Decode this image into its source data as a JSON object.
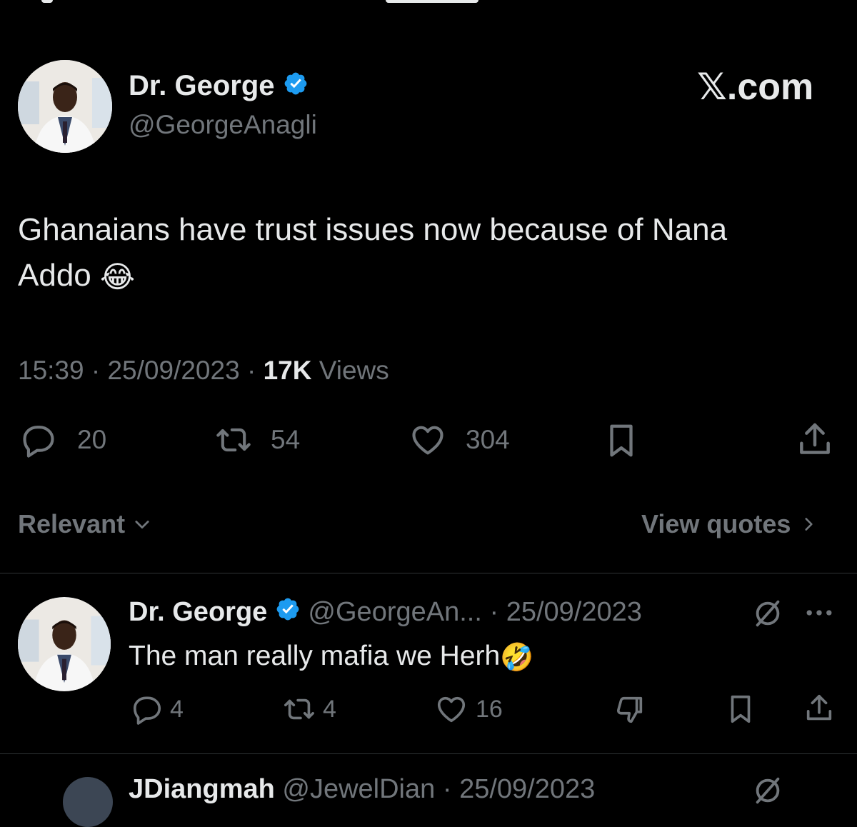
{
  "brand": {
    "logo_text": "𝕏.com"
  },
  "main_tweet": {
    "author_name": "Dr. George",
    "author_handle": "@GeorgeAnagli",
    "text_line1": "Ghanaians have trust issues now because of Nana",
    "text_line2": "Addo",
    "text_emoji": "😂",
    "time": "15:39",
    "sep1": "·",
    "date": "25/09/2023",
    "sep2": "·",
    "views_count": "17K",
    "views_label": "Views",
    "replies": "20",
    "reposts": "54",
    "likes": "304"
  },
  "sort": {
    "label": "Relevant",
    "view_quotes": "View quotes"
  },
  "reply": {
    "author_name": "Dr. George",
    "author_handle": "@GeorgeAn...",
    "sep": "·",
    "date": "25/09/2023",
    "text": "The man really mafia we Herh",
    "text_emoji": "🤣",
    "replies": "4",
    "reposts": "4",
    "likes": "16"
  },
  "next_reply": {
    "author_name": "JDiangmah",
    "author_handle": "@JewelDian",
    "sep": "·",
    "date": "25/09/2023"
  },
  "colors": {
    "background": "#000000",
    "text": "#e7e9ea",
    "muted": "#71767b",
    "verified": "#1d9bf0",
    "divider": "#2f3336"
  }
}
